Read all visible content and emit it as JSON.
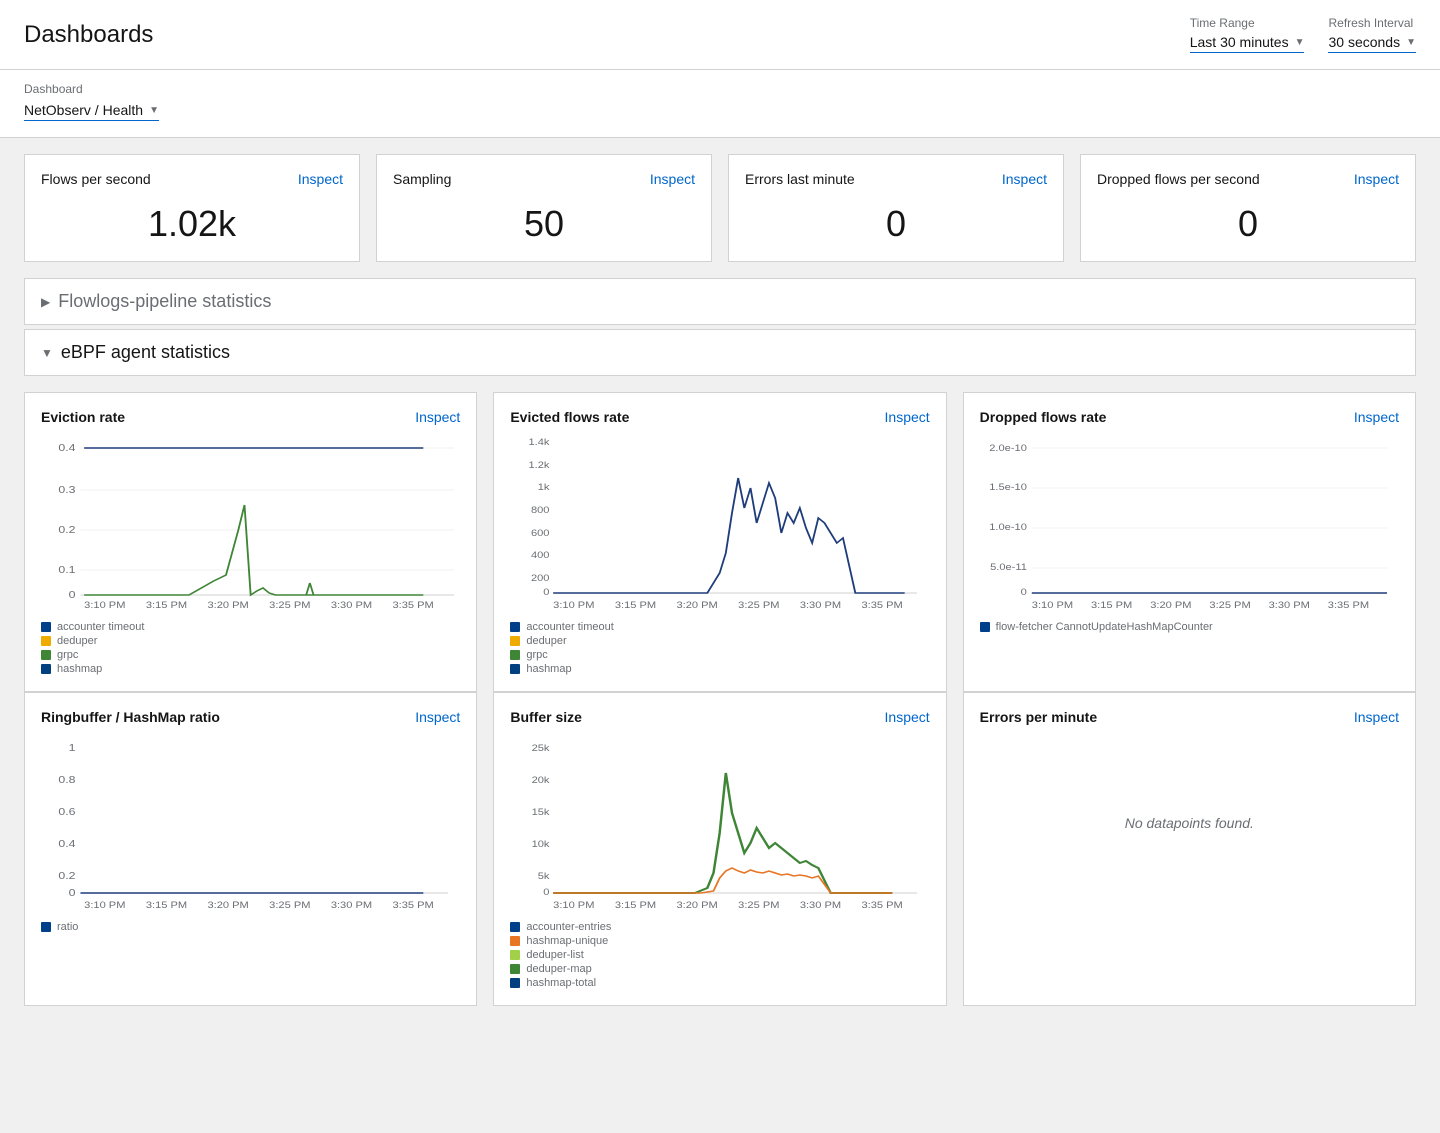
{
  "header": {
    "title": "Dashboards",
    "time_range_label": "Time Range",
    "time_range_value": "Last 30 minutes",
    "refresh_label": "Refresh Interval",
    "refresh_value": "30 seconds"
  },
  "subheader": {
    "label": "Dashboard",
    "value": "NetObserv / Health"
  },
  "stat_cards": [
    {
      "title": "Flows per second",
      "value": "1.02k",
      "inspect": "Inspect"
    },
    {
      "title": "Sampling",
      "value": "50",
      "inspect": "Inspect"
    },
    {
      "title": "Errors last minute",
      "value": "0",
      "inspect": "Inspect"
    },
    {
      "title": "Dropped flows per second",
      "value": "0",
      "inspect": "Inspect"
    }
  ],
  "sections": [
    {
      "id": "flowlogs",
      "label": "Flowlogs-pipeline statistics",
      "expanded": false
    },
    {
      "id": "ebpf",
      "label": "eBPF agent statistics",
      "expanded": true
    }
  ],
  "charts_row1": [
    {
      "id": "eviction-rate",
      "title": "Eviction rate",
      "inspect": "Inspect",
      "yLabels": [
        "0.4",
        "0.3",
        "0.2",
        "0.1",
        "0"
      ],
      "xLabels": [
        "3:10 PM",
        "3:15 PM",
        "3:20 PM",
        "3:25 PM",
        "3:30 PM",
        "3:35 PM"
      ],
      "legend": [
        {
          "color": "#003f8a",
          "label": "accounter timeout"
        },
        {
          "color": "#f0ab00",
          "label": "deduper"
        },
        {
          "color": "#3e8635",
          "label": "grpc"
        },
        {
          "color": "#004080",
          "label": "hashmap"
        }
      ]
    },
    {
      "id": "evicted-flows-rate",
      "title": "Evicted flows rate",
      "inspect": "Inspect",
      "yLabels": [
        "1.4k",
        "1.2k",
        "1k",
        "800",
        "600",
        "400",
        "200",
        "0"
      ],
      "xLabels": [
        "3:10 PM",
        "3:15 PM",
        "3:20 PM",
        "3:25 PM",
        "3:30 PM",
        "3:35 PM"
      ],
      "legend": [
        {
          "color": "#003f8a",
          "label": "accounter timeout"
        },
        {
          "color": "#f0ab00",
          "label": "deduper"
        },
        {
          "color": "#3e8635",
          "label": "grpc"
        },
        {
          "color": "#004080",
          "label": "hashmap"
        }
      ]
    },
    {
      "id": "dropped-flows-rate",
      "title": "Dropped flows rate",
      "inspect": "Inspect",
      "yLabels": [
        "2.0e-10",
        "1.5e-10",
        "1.0e-10",
        "5.0e-11",
        "0"
      ],
      "xLabels": [
        "3:10 PM",
        "3:15 PM",
        "3:20 PM",
        "3:25 PM",
        "3:30 PM",
        "3:35 PM"
      ],
      "legend": [
        {
          "color": "#003f8a",
          "label": "flow-fetcher CannotUpdateHashMapCounter"
        }
      ]
    }
  ],
  "charts_row2": [
    {
      "id": "ringbuffer-hashmap-ratio",
      "title": "Ringbuffer / HashMap ratio",
      "inspect": "Inspect",
      "yLabels": [
        "1",
        "0.8",
        "0.6",
        "0.4",
        "0.2",
        "0"
      ],
      "xLabels": [
        "3:10 PM",
        "3:15 PM",
        "3:20 PM",
        "3:25 PM",
        "3:30 PM",
        "3:35 PM"
      ],
      "legend": [
        {
          "color": "#003f8a",
          "label": "ratio"
        }
      ]
    },
    {
      "id": "buffer-size",
      "title": "Buffer size",
      "inspect": "Inspect",
      "yLabels": [
        "25k",
        "20k",
        "15k",
        "10k",
        "5k",
        "0"
      ],
      "xLabels": [
        "3:10 PM",
        "3:15 PM",
        "3:20 PM",
        "3:25 PM",
        "3:30 PM",
        "3:35 PM"
      ],
      "legend": [
        {
          "color": "#003f8a",
          "label": "accounter-entries"
        },
        {
          "color": "#e77524",
          "label": "hashmap-unique"
        },
        {
          "color": "#a2d149",
          "label": "deduper-list"
        },
        {
          "color": "#3e8635",
          "label": "deduper-map"
        },
        {
          "color": "#004080",
          "label": "hashmap-total"
        }
      ]
    },
    {
      "id": "errors-per-minute",
      "title": "Errors per minute",
      "inspect": "Inspect",
      "noData": "No datapoints found.",
      "legend": []
    }
  ]
}
